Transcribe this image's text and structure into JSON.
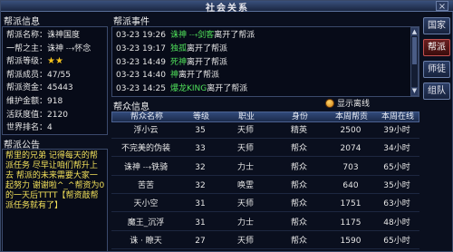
{
  "window": {
    "title": "社会关系",
    "close_glyph": "×"
  },
  "guild_info": {
    "label": "帮派信息",
    "rows": [
      {
        "key": "帮派名称：",
        "value": "诛神国度",
        "value_class": "v"
      },
      {
        "key": "一帮之主：",
        "value": "诛神 ⤏怀念",
        "value_class": "v"
      },
      {
        "key": "帮派等级：",
        "value": "★★",
        "value_class": "star"
      },
      {
        "key": "帮派成员：",
        "value": "47/55",
        "value_class": "v"
      },
      {
        "key": "帮派资金：",
        "value": "45443",
        "value_class": "v"
      },
      {
        "key": "维护金额：",
        "value": "918",
        "value_class": "v"
      },
      {
        "key": "活跃度值：",
        "value": "2120",
        "value_class": "v"
      },
      {
        "key": "世界排名：",
        "value": "4",
        "value_class": "v"
      }
    ]
  },
  "guild_notice": {
    "label": "帮派公告",
    "text": "帮里的兄弟  记得每天的帮派任务  尽早让咱们帮升上去  帮派的未来需要大家一起努力  谢谢啦^_^帮资为0的一天后TTTT【帮资敲帮派任务就有了】"
  },
  "events": {
    "label": "帮派事件",
    "rows": [
      {
        "time": "03-23 19:26",
        "name": "诛神 ⤏剑客",
        "action": "离开了帮派"
      },
      {
        "time": "03-23 19:17",
        "name": "独孤",
        "action": "离开了帮派"
      },
      {
        "time": "03-23 14:49",
        "name": "死神",
        "action": "离开了帮派"
      },
      {
        "time": "03-23 14:40",
        "name": "神",
        "action": "离开了帮派"
      },
      {
        "time": "03-23 14:25",
        "name": "爆龙KING",
        "action": "离开了帮派"
      }
    ]
  },
  "members": {
    "label": "帮众信息",
    "show_offline": "显示离线",
    "columns": [
      "帮众名称",
      "等级",
      "职业",
      "身份",
      "本周帮贡",
      "本周在线"
    ],
    "rows": [
      [
        "浮小云",
        "35",
        "天师",
        "精英",
        "2500",
        "39小时"
      ],
      [
        "不完美的伪装",
        "33",
        "天师",
        "帮众",
        "2074",
        "34小时"
      ],
      [
        "诛神 ⤏铁骑",
        "32",
        "力士",
        "帮众",
        "703",
        "65小时"
      ],
      [
        "苦苦",
        "32",
        "唤霊",
        "帮众",
        "640",
        "35小时"
      ],
      [
        "天小空",
        "31",
        "天师",
        "帮众",
        "1751",
        "63小时"
      ],
      [
        "魔王_沉浮",
        "31",
        "力士",
        "帮众",
        "1175",
        "48小时"
      ],
      [
        "诛 · 瞭天",
        "27",
        "天师",
        "帮众",
        "1590",
        "65小时"
      ]
    ]
  },
  "nav": {
    "buttons": [
      {
        "label": "国家",
        "active": false
      },
      {
        "label": "帮派",
        "active": true
      },
      {
        "label": "师徒",
        "active": false
      },
      {
        "label": "组队",
        "active": false
      }
    ]
  }
}
